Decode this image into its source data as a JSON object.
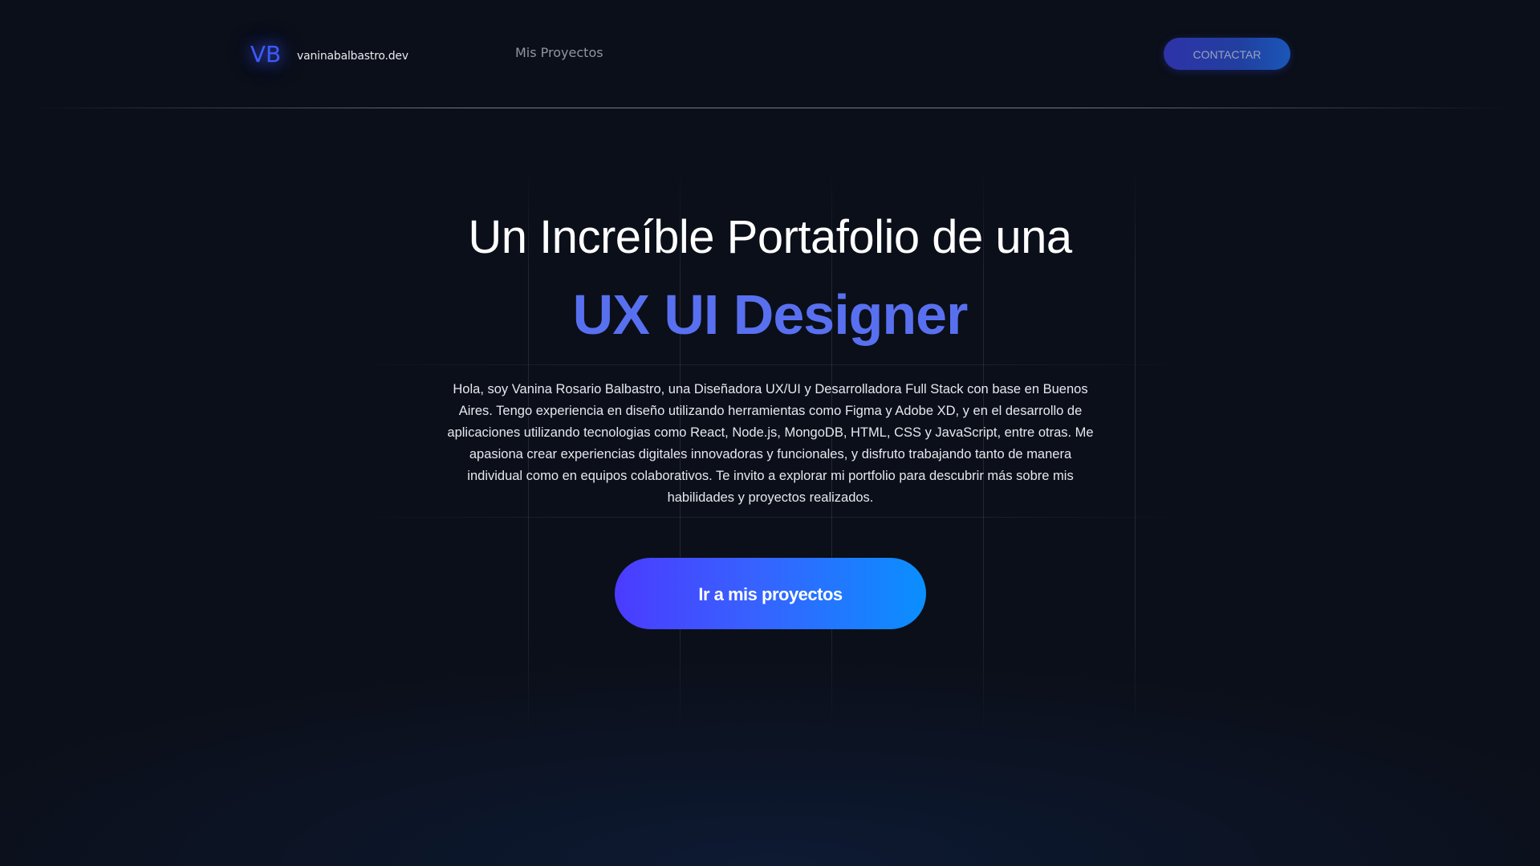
{
  "header": {
    "logo": "VB",
    "domain": "vaninabalbastro.dev",
    "nav": {
      "projects_label": "Mis Proyectos"
    },
    "contact_label": "CONTACTAR"
  },
  "hero": {
    "title": "Un Increíble Portafolio de una",
    "highlight": "UX UI Designer",
    "description": "Hola, soy Vanina Rosario Balbastro, una Diseñadora UX/UI y Desarrolladora Full Stack con base en Buenos Aires. Tengo experiencia en diseño utilizando herramientas como Figma y Adobe XD, y en el desarrollo de aplicaciones utilizando tecnologias como React, Node.js, MongoDB, HTML, CSS y JavaScript, entre otras. Me apasiona crear experiencias digitales innovadoras y funcionales, y disfruto trabajando tanto de manera individual como en equipos colaborativos. Te invito a explorar mi portfolio para descubrir más sobre mis habilidades y proyectos realizados.",
    "cta_label": "Ir a mis proyectos"
  },
  "colors": {
    "background": "#0b0f19",
    "accent": "#5870f0",
    "cta_start": "#4b3bff",
    "cta_end": "#0a8fff"
  }
}
